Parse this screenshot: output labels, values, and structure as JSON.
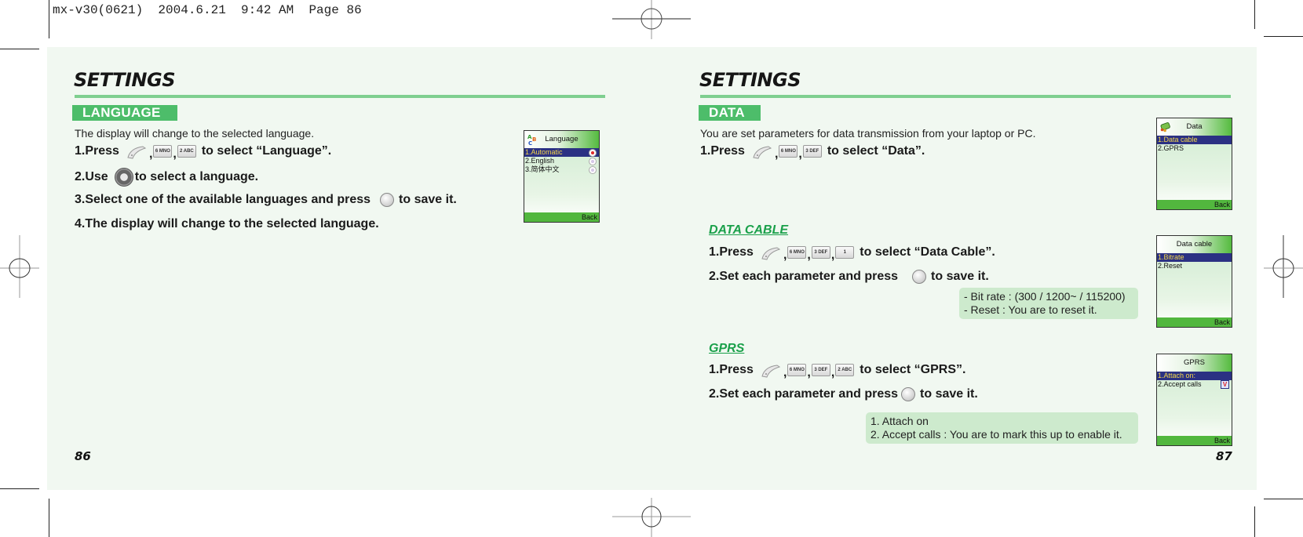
{
  "print_header": "mx-v30(0621)  2004.6.21  9:42 AM  Page 86",
  "left_page": {
    "title": "SETTINGS",
    "section": "LANGUAGE",
    "intro": "The display will change to the selected language.",
    "steps": [
      {
        "prefix": "1.Press",
        "keys": [
          "menu-softkey",
          "6 MNO",
          "2 ABC"
        ],
        "suffix": "to select “Language”."
      },
      {
        "prefix": "2.Use",
        "icon": "navigation-key",
        "suffix": "to select a language."
      },
      {
        "prefix": "3.Select one of the available languages and press",
        "icon": "ok-key",
        "suffix": "to save it."
      },
      {
        "prefix": "4.The display will change to the selected language."
      }
    ],
    "page_number": "86",
    "phone_screen": {
      "title": "Language",
      "items": [
        {
          "label": "1.Automatic",
          "selected": true,
          "radio": "on"
        },
        {
          "label": "2.English",
          "selected": false,
          "radio": "off"
        },
        {
          "label": "3.简体中文",
          "selected": false,
          "radio": "off"
        }
      ],
      "softkey": "Back"
    }
  },
  "right_page": {
    "title": "SETTINGS",
    "section": "DATA",
    "intro": "You are set parameters for data transmission from your laptop or PC.",
    "step1": {
      "prefix": "1.Press",
      "keys": [
        "menu-softkey",
        "6 MNO",
        "3 DEF"
      ],
      "suffix": "to select “Data”."
    },
    "data_screen": {
      "title": "Data",
      "items": [
        {
          "label": "1.Data cable",
          "selected": true
        },
        {
          "label": "2.GPRS",
          "selected": false
        }
      ],
      "softkey": "Back"
    },
    "data_cable": {
      "heading": "DATA CABLE",
      "step1": {
        "prefix": "1.Press",
        "keys": [
          "menu-softkey",
          "6 MNO",
          "3 DEF",
          "1"
        ],
        "suffix": "to select “Data Cable”."
      },
      "step2": {
        "prefix": "2.Set each parameter and press",
        "suffix": "to save it."
      },
      "notes": [
        "- Bit rate : (300 / 1200~ / 115200)",
        "- Reset : You are to reset it."
      ],
      "screen": {
        "title": "Data cable",
        "items": [
          {
            "label": "1.Bitrate",
            "selected": true
          },
          {
            "label": "2.Reset",
            "selected": false
          }
        ],
        "softkey": "Back"
      }
    },
    "gprs": {
      "heading": "GPRS",
      "step1": {
        "prefix": "1.Press",
        "keys": [
          "menu-softkey",
          "6 MNO",
          "3 DEF",
          "2 ABC"
        ],
        "suffix": "to select “GPRS”."
      },
      "step2": {
        "prefix": "2.Set each parameter and press",
        "suffix": "to save it."
      },
      "notes": [
        "1. Attach on",
        "2. Accept calls : You are to mark this up to enable it."
      ],
      "screen": {
        "title": "GPRS",
        "items": [
          {
            "label": "1.Attach on:",
            "selected": true
          },
          {
            "label": "2.Accept calls",
            "selected": false,
            "checked": true,
            "check_glyph": "V"
          }
        ],
        "softkey": "Back"
      }
    },
    "page_number": "87"
  },
  "colors": {
    "sheet_bg": "#f1f8f1",
    "accent_green": "#4dbd6a",
    "rule_green": "#7fcf8f",
    "subhead_green": "#1aa04a",
    "note_bg": "#cdeacd",
    "phone_selection": "#2b3183",
    "phone_selection_text": "#f6d84a"
  }
}
